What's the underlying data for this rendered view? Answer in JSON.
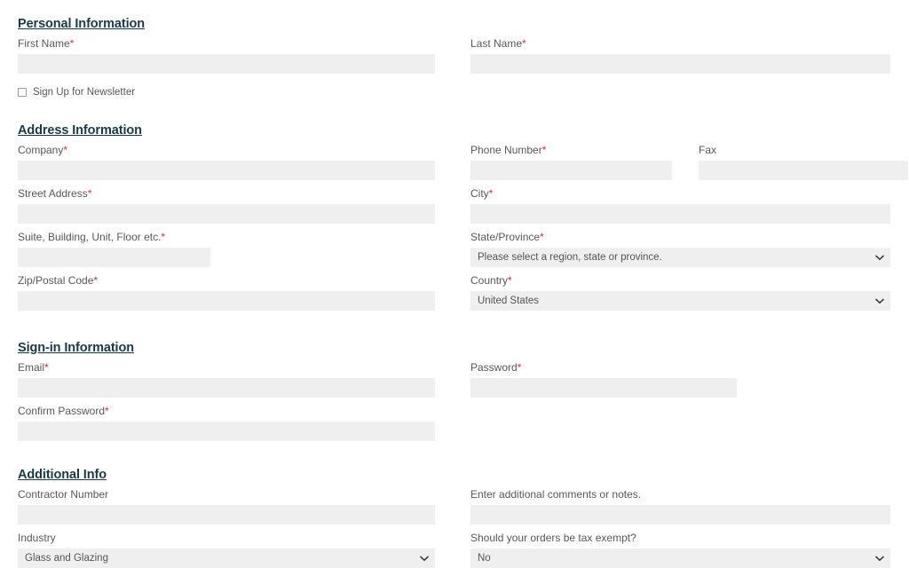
{
  "form": {
    "required_marker": "*",
    "accent_heading_color": "#17394c",
    "required_color": "#e02b27",
    "input_background": "#efefef",
    "label_color": "#575757",
    "sections": [
      {
        "id": "personal",
        "legend": "Personal Information",
        "fields": {
          "first_name_label": "First Name",
          "first_name_value": "",
          "last_name_label": "Last Name",
          "last_name_value": "",
          "newsletter_label": "Sign Up for Newsletter",
          "newsletter_checked": "false"
        }
      },
      {
        "id": "address",
        "legend": "Address Information",
        "fields": {
          "company_label": "Company",
          "company_value": "",
          "phone_label": "Phone Number",
          "phone_value": "",
          "fax_label": "Fax",
          "fax_value": "",
          "street_label": "Street Address",
          "street_value": "",
          "city_label": "City",
          "city_value": "",
          "suite_label": "Suite, Building, Unit, Floor etc.",
          "suite_value": "",
          "state_label": "State/Province",
          "state_value": "Please select a region, state or province.",
          "zip_label": "Zip/Postal Code",
          "zip_value": "",
          "country_label": "Country",
          "country_value": "United States"
        }
      },
      {
        "id": "signin",
        "legend": "Sign-in Information",
        "fields": {
          "email_label": "Email",
          "email_value": "",
          "password_label": "Password",
          "password_value": "",
          "confirm_password_label": "Confirm Password",
          "confirm_password_value": ""
        }
      },
      {
        "id": "additional",
        "legend": "Additional Info",
        "fields": {
          "contractor_label": "Contractor Number",
          "contractor_value": "",
          "comments_label": "Enter additional comments or notes.",
          "comments_value": "",
          "industry_label": "Industry",
          "industry_value": "Glass and Glazing",
          "tax_exempt_label": "Should your orders be tax exempt?",
          "tax_exempt_value": "No"
        }
      }
    ],
    "icons": {
      "chevron_down": "chevron-down-icon",
      "checkbox": "checkbox-icon"
    }
  }
}
